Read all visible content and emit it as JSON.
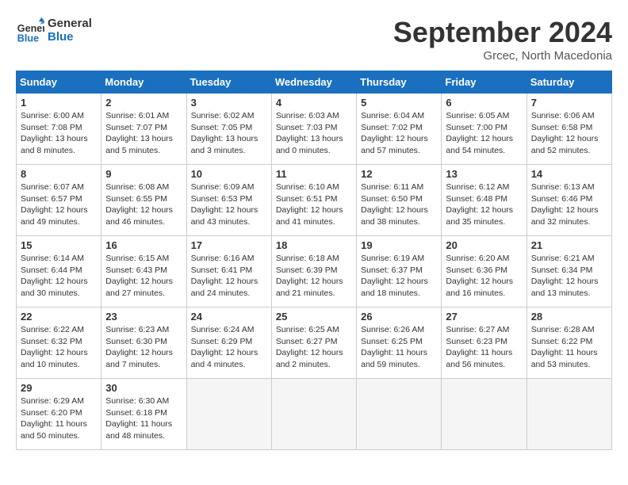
{
  "header": {
    "logo_line1": "General",
    "logo_line2": "Blue",
    "month": "September 2024",
    "location": "Grcec, North Macedonia"
  },
  "columns": [
    "Sunday",
    "Monday",
    "Tuesday",
    "Wednesday",
    "Thursday",
    "Friday",
    "Saturday"
  ],
  "weeks": [
    [
      {
        "day": "1",
        "rise": "6:00 AM",
        "set": "7:08 PM",
        "daylight": "13 hours and 8 minutes."
      },
      {
        "day": "2",
        "rise": "6:01 AM",
        "set": "7:07 PM",
        "daylight": "13 hours and 5 minutes."
      },
      {
        "day": "3",
        "rise": "6:02 AM",
        "set": "7:05 PM",
        "daylight": "13 hours and 3 minutes."
      },
      {
        "day": "4",
        "rise": "6:03 AM",
        "set": "7:03 PM",
        "daylight": "13 hours and 0 minutes."
      },
      {
        "day": "5",
        "rise": "6:04 AM",
        "set": "7:02 PM",
        "daylight": "12 hours and 57 minutes."
      },
      {
        "day": "6",
        "rise": "6:05 AM",
        "set": "7:00 PM",
        "daylight": "12 hours and 54 minutes."
      },
      {
        "day": "7",
        "rise": "6:06 AM",
        "set": "6:58 PM",
        "daylight": "12 hours and 52 minutes."
      }
    ],
    [
      {
        "day": "8",
        "rise": "6:07 AM",
        "set": "6:57 PM",
        "daylight": "12 hours and 49 minutes."
      },
      {
        "day": "9",
        "rise": "6:08 AM",
        "set": "6:55 PM",
        "daylight": "12 hours and 46 minutes."
      },
      {
        "day": "10",
        "rise": "6:09 AM",
        "set": "6:53 PM",
        "daylight": "12 hours and 43 minutes."
      },
      {
        "day": "11",
        "rise": "6:10 AM",
        "set": "6:51 PM",
        "daylight": "12 hours and 41 minutes."
      },
      {
        "day": "12",
        "rise": "6:11 AM",
        "set": "6:50 PM",
        "daylight": "12 hours and 38 minutes."
      },
      {
        "day": "13",
        "rise": "6:12 AM",
        "set": "6:48 PM",
        "daylight": "12 hours and 35 minutes."
      },
      {
        "day": "14",
        "rise": "6:13 AM",
        "set": "6:46 PM",
        "daylight": "12 hours and 32 minutes."
      }
    ],
    [
      {
        "day": "15",
        "rise": "6:14 AM",
        "set": "6:44 PM",
        "daylight": "12 hours and 30 minutes."
      },
      {
        "day": "16",
        "rise": "6:15 AM",
        "set": "6:43 PM",
        "daylight": "12 hours and 27 minutes."
      },
      {
        "day": "17",
        "rise": "6:16 AM",
        "set": "6:41 PM",
        "daylight": "12 hours and 24 minutes."
      },
      {
        "day": "18",
        "rise": "6:18 AM",
        "set": "6:39 PM",
        "daylight": "12 hours and 21 minutes."
      },
      {
        "day": "19",
        "rise": "6:19 AM",
        "set": "6:37 PM",
        "daylight": "12 hours and 18 minutes."
      },
      {
        "day": "20",
        "rise": "6:20 AM",
        "set": "6:36 PM",
        "daylight": "12 hours and 16 minutes."
      },
      {
        "day": "21",
        "rise": "6:21 AM",
        "set": "6:34 PM",
        "daylight": "12 hours and 13 minutes."
      }
    ],
    [
      {
        "day": "22",
        "rise": "6:22 AM",
        "set": "6:32 PM",
        "daylight": "12 hours and 10 minutes."
      },
      {
        "day": "23",
        "rise": "6:23 AM",
        "set": "6:30 PM",
        "daylight": "12 hours and 7 minutes."
      },
      {
        "day": "24",
        "rise": "6:24 AM",
        "set": "6:29 PM",
        "daylight": "12 hours and 4 minutes."
      },
      {
        "day": "25",
        "rise": "6:25 AM",
        "set": "6:27 PM",
        "daylight": "12 hours and 2 minutes."
      },
      {
        "day": "26",
        "rise": "6:26 AM",
        "set": "6:25 PM",
        "daylight": "11 hours and 59 minutes."
      },
      {
        "day": "27",
        "rise": "6:27 AM",
        "set": "6:23 PM",
        "daylight": "11 hours and 56 minutes."
      },
      {
        "day": "28",
        "rise": "6:28 AM",
        "set": "6:22 PM",
        "daylight": "11 hours and 53 minutes."
      }
    ],
    [
      {
        "day": "29",
        "rise": "6:29 AM",
        "set": "6:20 PM",
        "daylight": "11 hours and 50 minutes."
      },
      {
        "day": "30",
        "rise": "6:30 AM",
        "set": "6:18 PM",
        "daylight": "11 hours and 48 minutes."
      },
      null,
      null,
      null,
      null,
      null
    ]
  ]
}
